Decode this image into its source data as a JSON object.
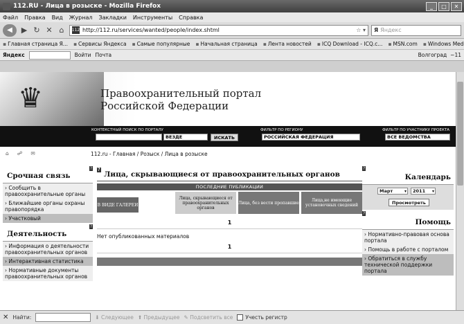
{
  "window": {
    "title": "112.RU - Лица в розыске - Mozilla Firefox",
    "controls": [
      "_",
      "□",
      "✕"
    ]
  },
  "menu": [
    "Файл",
    "Правка",
    "Вид",
    "Журнал",
    "Закладки",
    "Инструменты",
    "Справка"
  ],
  "nav": {
    "url": "http://112.ru/services/wanted/people/index.shtml",
    "search_placeholder": "Яндекс",
    "search_logo": "Я"
  },
  "bookmarks": [
    "Главная страница Я...",
    "Сервисы Яндекса",
    "Самые популярные",
    "Начальная страница",
    "Лента новостей",
    "ICQ Download - ICQ.c...",
    "MSN.com",
    "Windows Media"
  ],
  "yandexbar": {
    "logo": "Яндекс",
    "login": "Войти",
    "mail": "Почта",
    "city": "Волгоград",
    "temp": "−11"
  },
  "portal": {
    "title_line1": "Правоохранительный портал",
    "title_line2": "Российской Федерации"
  },
  "searchstrip": {
    "context_label": "КОНТЕКСТНЫЙ ПОИСК ПО ПОРТАЛУ",
    "where": "ВЕЗДЕ",
    "search_btn": "ИСКАТЬ",
    "region_label": "ФИЛЬТР ПО РЕГИОНУ",
    "region": "РОССИЙСКАЯ ФЕДЕРАЦИЯ",
    "participant_label": "ФИЛЬТР ПО УЧАСТНИКУ ПРОЕКТА",
    "participant": "ВСЕ ВЕДОМСТВА"
  },
  "breadcrumb": "112.ru - Главная / Розыск / Лица в розыске",
  "left": {
    "urgent_title": "Срочная связь",
    "urgent_items": [
      "Сообщить в правоохранительные органы",
      "Ближайшие органы охраны правопорядка",
      "Участковый"
    ],
    "activity_title": "Деятельность",
    "activity_items": [
      "Информация о деятельности правоохранительных органов",
      "Интерактивная статистика",
      "Нормативные документы правоохранительных органов"
    ]
  },
  "center": {
    "title": "Лица, скрывающиеся от правоохранительных органов",
    "pub_bar": "ПОСЛЕДНИЕ ПУБЛИКАЦИИ",
    "tabs": [
      "В ВИДЕ ГАЛЕРЕИ",
      "Лица, скрывающиеся от правоохранительных органов",
      "Лица, без вести пропавшие",
      "Лица,не имеющие установочных сведений"
    ],
    "page_num": "1",
    "no_materials": "Нет опубликованных материалов"
  },
  "right": {
    "calendar_title": "Календарь",
    "month": "Март",
    "year": "2011",
    "view_btn": "Просмотреть",
    "help_title": "Помощь",
    "help_items": [
      "Нормативно-правовая основа портала",
      "Помощь в работе с порталом",
      "Обратиться в службу технической поддержки портала"
    ]
  },
  "findbar": {
    "label": "Найти:",
    "next": "Следующее",
    "prev": "Предыдущее",
    "highlight": "Подсветить все",
    "match_case": "Учесть регистр"
  }
}
